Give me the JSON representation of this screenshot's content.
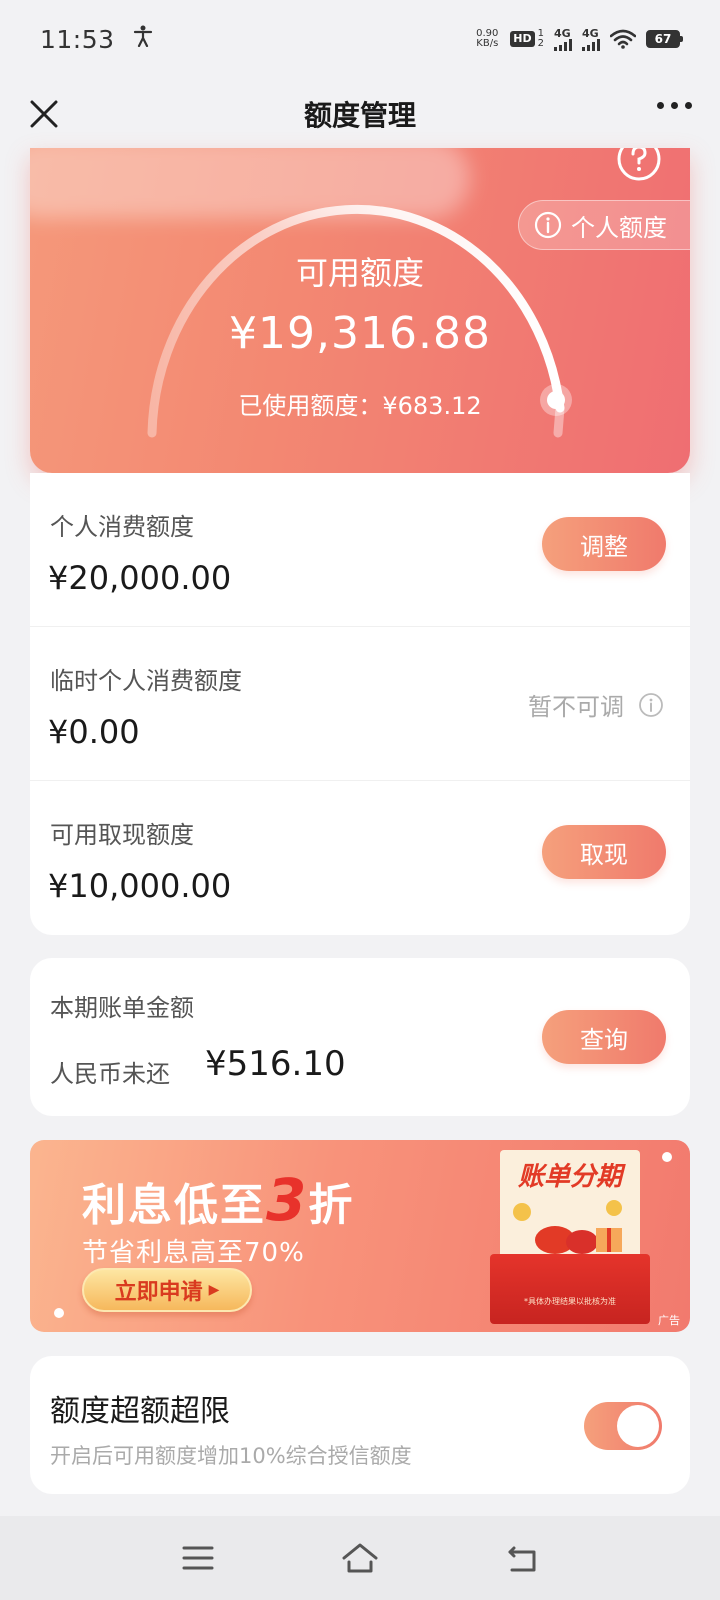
{
  "status_bar": {
    "time": "11:53",
    "net_speed_value": "0.90",
    "net_speed_unit": "KB/s",
    "hd_label": "HD",
    "sim1_index": "1",
    "sim2_index": "2",
    "signal1_label": "4G",
    "signal2_label": "4G",
    "battery": "67"
  },
  "nav": {
    "title": "额度管理"
  },
  "hero": {
    "personal_limit_label": "个人额度",
    "available_label": "可用额度",
    "available_amount": "¥19,316.88",
    "used_label": "已使用额度：¥683.12",
    "used_fraction": 0.034
  },
  "limits": [
    {
      "label": "个人消费额度",
      "value": "¥20,000.00",
      "action": "调整"
    },
    {
      "label": "临时个人消费额度",
      "value": "¥0.00",
      "status": "暂不可调"
    },
    {
      "label": "可用取现额度",
      "value": "¥10,000.00",
      "action": "取现"
    }
  ],
  "bill": {
    "label": "本期账单金额",
    "currency_label": "人民币未还",
    "amount": "¥516.10",
    "action": "查询"
  },
  "promo": {
    "title_prefix": "利息低至",
    "title_big": "3",
    "title_suffix": "折",
    "subtitle": "节省利息高至70%",
    "button": "立即申请",
    "art_title": "账单分期",
    "art_note": "*具体办理结果以批核为准",
    "ad_tag": "广告"
  },
  "overlimit": {
    "title": "额度超额超限",
    "description": "开启后可用额度增加10%综合授信额度",
    "enabled": true
  },
  "colors": {
    "accent_start": "#f5a07c",
    "accent_end": "#f07a6c",
    "hero_start": "#f5987a",
    "hero_end": "#ef6e72"
  }
}
